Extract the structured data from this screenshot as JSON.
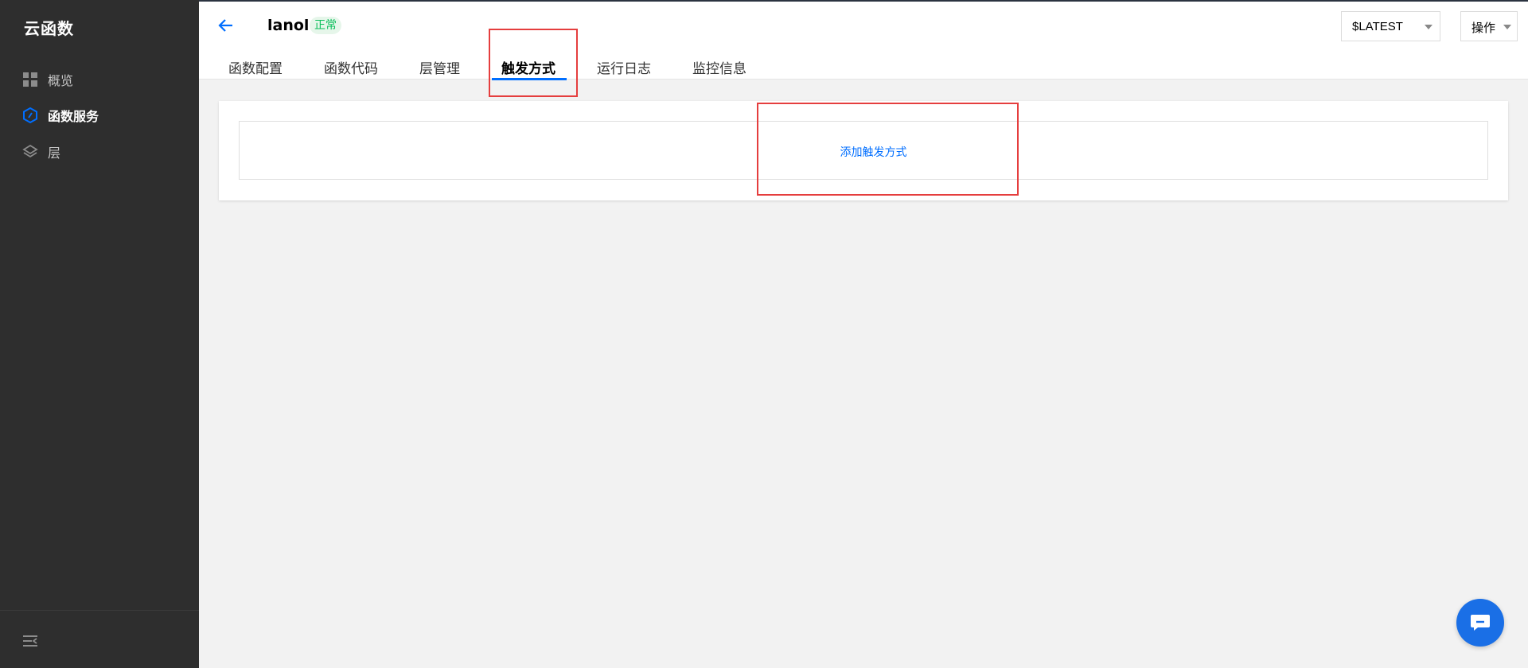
{
  "sidebar": {
    "app_title": "云函数",
    "items": [
      {
        "label": "概览",
        "icon": "dashboard-icon"
      },
      {
        "label": "函数服务",
        "icon": "function-icon",
        "active": true
      },
      {
        "label": "层",
        "icon": "layers-icon"
      }
    ],
    "collapse_icon": "collapse-sidebar-icon"
  },
  "header": {
    "back_icon": "arrow-left-icon",
    "function_name": "lanol",
    "status": "正常",
    "tabs": [
      {
        "label": "函数配置"
      },
      {
        "label": "函数代码"
      },
      {
        "label": "层管理"
      },
      {
        "label": "触发方式",
        "active": true
      },
      {
        "label": "运行日志"
      },
      {
        "label": "监控信息"
      }
    ],
    "version_select": {
      "value": "$LATEST"
    },
    "ops_button": {
      "label": "操作"
    }
  },
  "main": {
    "add_trigger_label": "添加触发方式"
  },
  "chat_button": {
    "icon": "chat-bubble-icon"
  },
  "colors": {
    "sidebar_bg": "#2e2e2e",
    "accent": "#006eff",
    "status_green": "#0abf5b",
    "annotation_red": "#e53e3e",
    "page_bg": "#f2f2f2"
  }
}
